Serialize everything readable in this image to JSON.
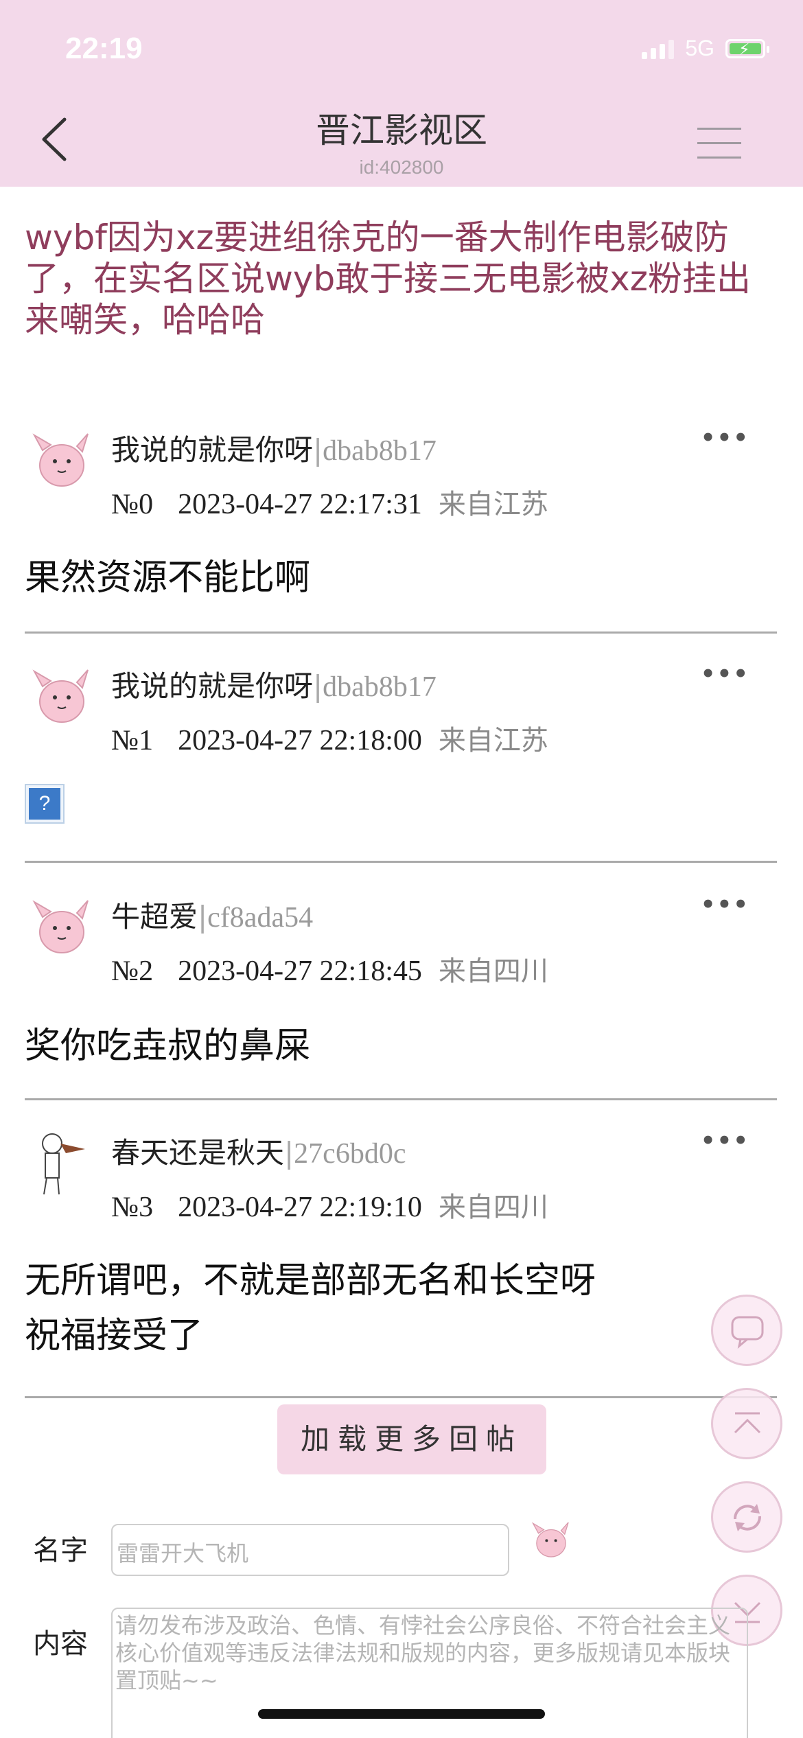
{
  "status_bar": {
    "time": "22:19",
    "network": "5G"
  },
  "header": {
    "title": "晋江影视区",
    "subtitle": "id:402800"
  },
  "topic": "wybf因为xz要进组徐克的一番大制作电影破防了，在实名区说wyb敢于接三无电影被xz粉挂出来嘲笑，哈哈哈",
  "posts": [
    {
      "author": "我说的就是你呀",
      "uid": "dbab8b17",
      "no": "№0",
      "time": "2023-04-27 22:17:31",
      "location": "来自江苏",
      "content": "果然资源不能比啊"
    },
    {
      "author": "我说的就是你呀",
      "uid": "dbab8b17",
      "no": "№1",
      "time": "2023-04-27 22:18:00",
      "location": "来自江苏",
      "content": "?"
    },
    {
      "author": "牛超爱",
      "uid": "cf8ada54",
      "no": "№2",
      "time": "2023-04-27 22:18:45",
      "location": "来自四川",
      "content": "奖你吃垚叔的鼻屎"
    },
    {
      "author": "春天还是秋天",
      "uid": "27c6bd0c",
      "no": "№3",
      "time": "2023-04-27 22:19:10",
      "location": "来自四川",
      "content": "无所谓吧，不就是部部无名和长空呀",
      "content2": "祝福接受了"
    }
  ],
  "more_icon": "•••",
  "load_more": "加载更多回帖",
  "form": {
    "name_label": "名字",
    "name_value": "雷雷开大飞机",
    "content_label": "内容",
    "content_placeholder": "请勿发布涉及政治、色情、有悖社会公序良俗、不符合社会主义核心价值观等违反法律法规和版规的内容，更多版规请见本版块置顶贴~~"
  },
  "icons": {
    "back": "chevron-left-icon",
    "menu": "hamburger-menu-icon",
    "comment": "comment-bubble-icon",
    "top": "scroll-top-icon",
    "refresh": "refresh-icon",
    "bottom": "scroll-bottom-icon"
  },
  "colors": {
    "header_bg": "#f3d9ea",
    "topic_text": "#8f3d5c",
    "load_more_bg": "#f5d7e6"
  }
}
